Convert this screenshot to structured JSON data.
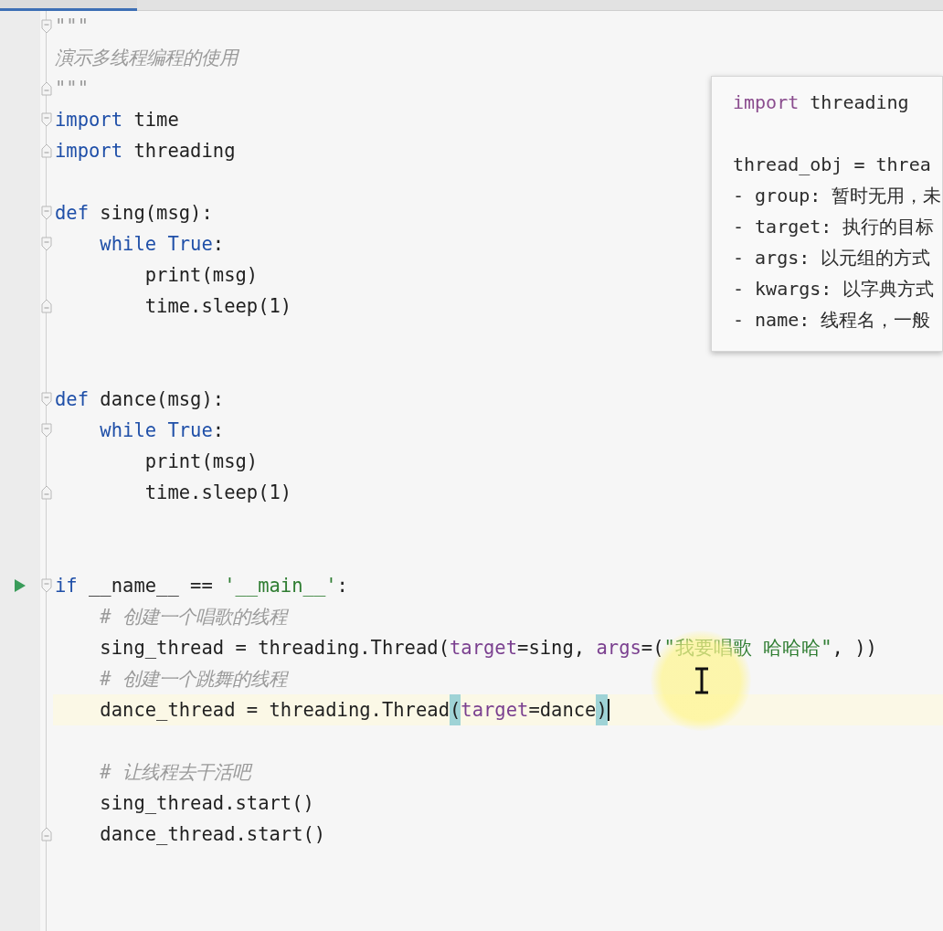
{
  "editor": {
    "lines": [
      {
        "kind": "code",
        "fold_start": true,
        "tokens": [
          {
            "kind": "doc",
            "text": "\"\"\""
          }
        ]
      },
      {
        "kind": "code",
        "tokens": [
          {
            "kind": "doc",
            "text": "演示多线程编程的使用"
          }
        ]
      },
      {
        "kind": "code",
        "fold_end": true,
        "tokens": [
          {
            "kind": "doc",
            "text": "\"\"\""
          }
        ]
      },
      {
        "kind": "code",
        "fold_start": true,
        "tokens": [
          {
            "kind": "keyword",
            "text": "import"
          },
          {
            "kind": "plain",
            "text": " time"
          }
        ]
      },
      {
        "kind": "code",
        "fold_end": true,
        "tokens": [
          {
            "kind": "keyword",
            "text": "import"
          },
          {
            "kind": "plain",
            "text": " threading"
          }
        ]
      },
      {
        "kind": "blank"
      },
      {
        "kind": "code",
        "fold_start": true,
        "tokens": [
          {
            "kind": "keyword",
            "text": "def"
          },
          {
            "kind": "plain",
            "text": " sing(msg):"
          }
        ]
      },
      {
        "kind": "code",
        "fold_start": true,
        "tokens": [
          {
            "kind": "keyword",
            "text": "    while"
          },
          {
            "kind": "keyword",
            "text": " True"
          },
          {
            "kind": "plain",
            "text": ":"
          }
        ]
      },
      {
        "kind": "code",
        "tokens": [
          {
            "kind": "plain",
            "text": "        print(msg)"
          }
        ]
      },
      {
        "kind": "code",
        "fold_end": true,
        "tokens": [
          {
            "kind": "plain",
            "text": "        time.sleep(1)"
          }
        ]
      },
      {
        "kind": "blank"
      },
      {
        "kind": "blank"
      },
      {
        "kind": "code",
        "fold_start": true,
        "tokens": [
          {
            "kind": "keyword",
            "text": "def"
          },
          {
            "kind": "plain",
            "text": " dance(msg):"
          }
        ]
      },
      {
        "kind": "code",
        "fold_start": true,
        "tokens": [
          {
            "kind": "keyword",
            "text": "    while"
          },
          {
            "kind": "keyword",
            "text": " True"
          },
          {
            "kind": "plain",
            "text": ":"
          }
        ]
      },
      {
        "kind": "code",
        "tokens": [
          {
            "kind": "plain",
            "text": "        print(msg)"
          }
        ]
      },
      {
        "kind": "code",
        "fold_end": true,
        "tokens": [
          {
            "kind": "plain",
            "text": "        time.sleep(1)"
          }
        ]
      },
      {
        "kind": "blank"
      },
      {
        "kind": "blank"
      },
      {
        "kind": "code",
        "run": true,
        "fold_start": true,
        "tokens": [
          {
            "kind": "keyword",
            "text": "if"
          },
          {
            "kind": "plain",
            "text": " __name__ == "
          },
          {
            "kind": "string",
            "text": "'__main__'"
          },
          {
            "kind": "plain",
            "text": ":"
          }
        ]
      },
      {
        "kind": "code",
        "tokens": [
          {
            "kind": "comment",
            "text": "    # 创建一个唱歌的线程"
          }
        ]
      },
      {
        "kind": "code",
        "tokens": [
          {
            "kind": "plain",
            "text": "    sing_thread = threading.Thread("
          },
          {
            "kind": "param",
            "text": "target"
          },
          {
            "kind": "plain",
            "text": "=sing, "
          },
          {
            "kind": "param",
            "text": "args"
          },
          {
            "kind": "plain",
            "text": "=("
          },
          {
            "kind": "string",
            "text": "\"我要唱歌 哈哈哈\""
          },
          {
            "kind": "plain",
            "text": ", ))"
          }
        ]
      },
      {
        "kind": "code",
        "tokens": [
          {
            "kind": "comment",
            "text": "    # 创建一个跳舞的线程"
          }
        ]
      },
      {
        "kind": "code",
        "current": true,
        "caret": true,
        "tokens": [
          {
            "kind": "plain",
            "text": "    dance_thread = threading.Thread"
          },
          {
            "kind": "bracket",
            "text": "("
          },
          {
            "kind": "param",
            "text": "target"
          },
          {
            "kind": "plain",
            "text": "=dance"
          },
          {
            "kind": "bracket",
            "text": ")"
          }
        ]
      },
      {
        "kind": "blank"
      },
      {
        "kind": "code",
        "tokens": [
          {
            "kind": "comment",
            "text": "    # 让线程去干活吧"
          }
        ]
      },
      {
        "kind": "code",
        "tokens": [
          {
            "kind": "plain",
            "text": "    sing_thread.start()"
          }
        ]
      },
      {
        "kind": "code",
        "fold_end": true,
        "tokens": [
          {
            "kind": "plain",
            "text": "    dance_thread.start()"
          }
        ]
      }
    ]
  },
  "doc_popup": {
    "lines": [
      {
        "kind": "code",
        "tokens": [
          {
            "kind": "keyword",
            "text": "import"
          },
          {
            "kind": "plain",
            "text": " threading"
          }
        ]
      },
      {
        "kind": "blank"
      },
      {
        "kind": "code",
        "tokens": [
          {
            "kind": "plain",
            "text": "thread_obj = threa"
          }
        ]
      },
      {
        "kind": "code",
        "tokens": [
          {
            "kind": "plain",
            "text": "- group: 暂时无用，未"
          }
        ]
      },
      {
        "kind": "code",
        "tokens": [
          {
            "kind": "plain",
            "text": "- target: 执行的目标"
          }
        ]
      },
      {
        "kind": "code",
        "tokens": [
          {
            "kind": "plain",
            "text": "- args: 以元组的方式"
          }
        ]
      },
      {
        "kind": "code",
        "tokens": [
          {
            "kind": "plain",
            "text": "- kwargs: 以字典方式"
          }
        ]
      },
      {
        "kind": "code",
        "tokens": [
          {
            "kind": "plain",
            "text": "- name: 线程名，一般"
          }
        ]
      }
    ]
  }
}
